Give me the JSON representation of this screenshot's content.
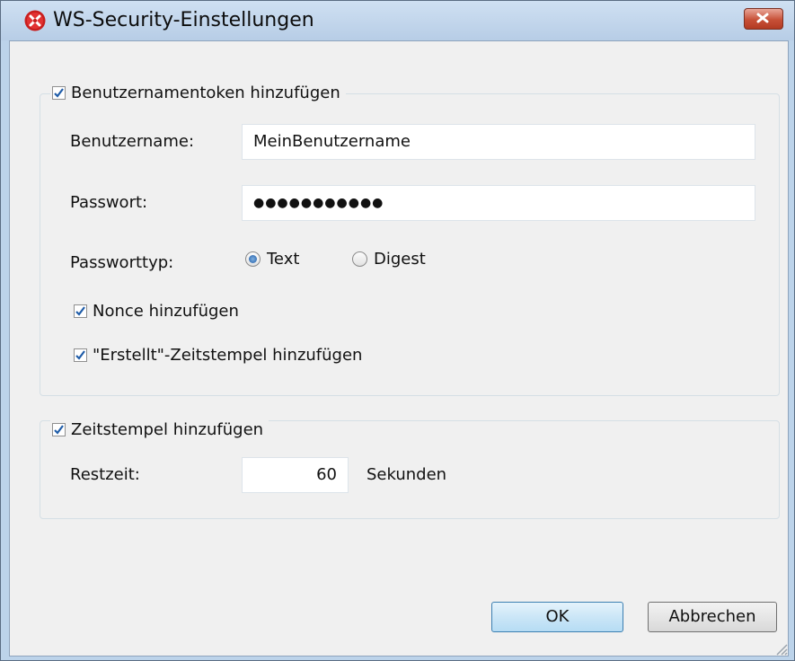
{
  "window": {
    "title": "WS-Security-Einstellungen",
    "close_label": "×"
  },
  "username_token_group": {
    "checkbox_label": "Benutzernamentoken hinzufügen",
    "checked": true,
    "username_label": "Benutzername:",
    "username_value": "MeinBenutzername",
    "password_label": "Passwort:",
    "password_mask": "●●●●●●●●●●●",
    "password_type_label": "Passworttyp:",
    "password_type_options": [
      {
        "label": "Text",
        "selected": true
      },
      {
        "label": "Digest",
        "selected": false
      }
    ],
    "nonce_label": "Nonce hinzufügen",
    "nonce_checked": true,
    "created_label": "\"Erstellt\"-Zeitstempel hinzufügen",
    "created_checked": true
  },
  "timestamp_group": {
    "checkbox_label": "Zeitstempel hinzufügen",
    "checked": true,
    "remaining_label": "Restzeit:",
    "remaining_value": "60",
    "unit_label": "Sekunden"
  },
  "buttons": {
    "ok_label": "OK",
    "cancel_label": "Abbrechen"
  },
  "colors": {
    "accent_check": "#1f5ca8",
    "frame": "#bcd3ea",
    "close_button": "#c75037"
  },
  "icons": {
    "app": "altova-logo-icon",
    "check": "checkmark-icon",
    "close": "close-icon",
    "grip": "resize-grip-icon"
  }
}
